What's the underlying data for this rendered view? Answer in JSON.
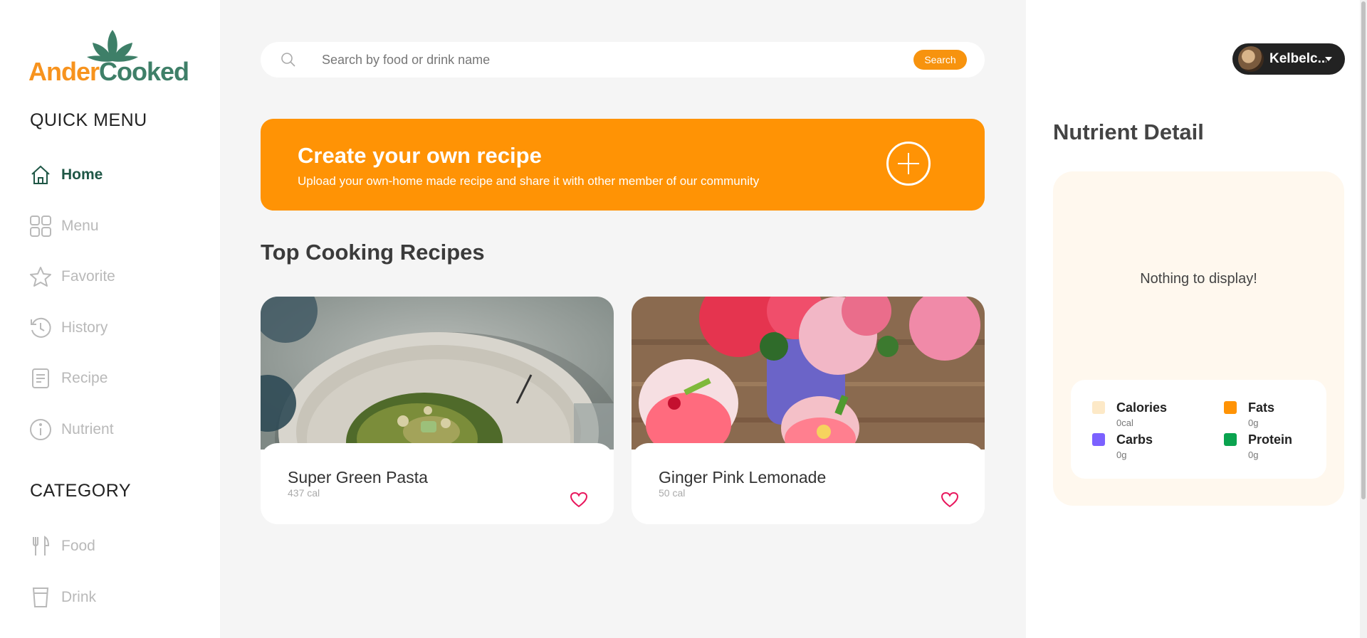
{
  "brand": {
    "part1": "Ander",
    "part2": "Cooked"
  },
  "sidebar": {
    "quick_menu_title": "QUICK MENU",
    "quick_menu": [
      {
        "label": "Home",
        "icon": "home-icon",
        "active": true
      },
      {
        "label": "Menu",
        "icon": "grid-icon"
      },
      {
        "label": "Favorite",
        "icon": "star-icon"
      },
      {
        "label": "History",
        "icon": "history-icon"
      },
      {
        "label": "Recipe",
        "icon": "document-icon"
      },
      {
        "label": "Nutrient",
        "icon": "info-icon"
      }
    ],
    "category_title": "CATEGORY",
    "categories": [
      {
        "label": "Food",
        "icon": "fork-knife-icon"
      },
      {
        "label": "Drink",
        "icon": "cup-icon"
      }
    ]
  },
  "search": {
    "placeholder": "Search by food or drink name",
    "value": "",
    "button_label": "Search"
  },
  "banner": {
    "title": "Create your own recipe",
    "subtitle": "Upload your own-home made recipe and share it with other member of our community"
  },
  "top_recipes": {
    "title": "Top Cooking Recipes",
    "items": [
      {
        "name": "Super Green Pasta",
        "calories": "437 cal"
      },
      {
        "name": "Ginger Pink Lemonade",
        "calories": "50 cal"
      }
    ]
  },
  "user": {
    "name": "Kelbelc..."
  },
  "nutrient": {
    "title": "Nutrient Detail",
    "empty_text": "Nothing to display!",
    "legend": [
      {
        "label": "Calories",
        "value": "0cal",
        "color": "#fde9c7"
      },
      {
        "label": "Fats",
        "value": "0g",
        "color": "#ff9305"
      },
      {
        "label": "Carbs",
        "value": "0g",
        "color": "#7b61ff"
      },
      {
        "label": "Protein",
        "value": "0g",
        "color": "#0aa34f"
      }
    ]
  },
  "colors": {
    "accent": "#ff9305",
    "brand_green": "#3e7f68",
    "active_nav": "#1f5746",
    "heart": "#e8175d"
  }
}
